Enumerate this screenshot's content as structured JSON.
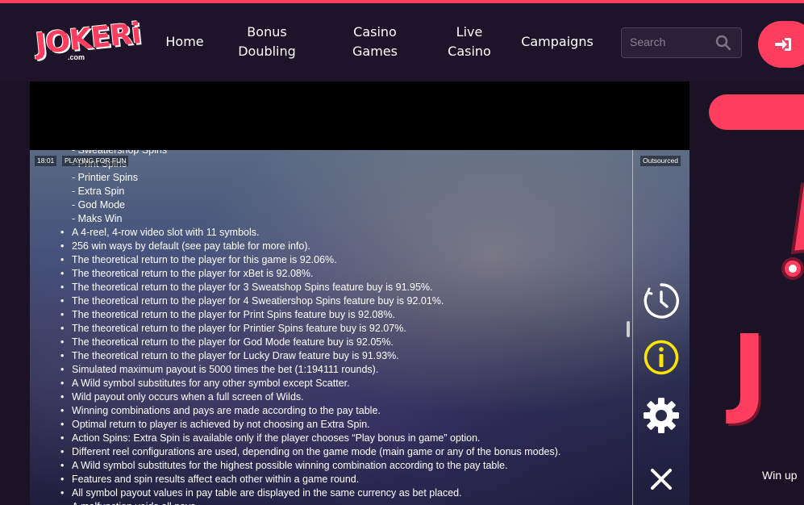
{
  "header": {
    "logo_text": "JOKERi",
    "logo_sub": ".com",
    "nav": [
      {
        "label": "Home"
      },
      {
        "label": "Bonus Doubling"
      },
      {
        "label": "Casino Games"
      },
      {
        "label": "Live Casino"
      },
      {
        "label": "Campaigns"
      }
    ],
    "search_placeholder": "Search",
    "login_icon": "login-icon"
  },
  "game": {
    "time": "18:01",
    "mode": "PLAYING FOR FUN",
    "provider_badge": "Outsourced",
    "lines": [
      {
        "type": "sub",
        "text": "- Sweatiershop Spins"
      },
      {
        "type": "sub",
        "text": "- Print Spins"
      },
      {
        "type": "sub",
        "text": "- Printier Spins"
      },
      {
        "type": "sub",
        "text": "- Extra Spin"
      },
      {
        "type": "sub",
        "text": "- God Mode"
      },
      {
        "type": "sub",
        "text": "- Maks Win"
      },
      {
        "type": "bullet",
        "text": "A 4-reel, 4-row video slot with 11 symbols."
      },
      {
        "type": "bullet",
        "text": "256 win ways by default (see pay table for more info)."
      },
      {
        "type": "bullet",
        "text": "The theoretical return to the player for this game is 92.06%."
      },
      {
        "type": "bullet",
        "text": "The theoretical return to the player for xBet is 92.08%."
      },
      {
        "type": "bullet",
        "text": "The theoretical return to the player for 3 Sweatshop Spins feature buy is 91.95%."
      },
      {
        "type": "bullet",
        "text": "The theoretical return to the player for 4 Sweatiershop Spins feature buy is 92.01%."
      },
      {
        "type": "bullet",
        "text": "The theoretical return to the player for Print Spins feature buy is 92.08%."
      },
      {
        "type": "bullet",
        "text": "The theoretical return to the player for Printier Spins feature buy is 92.07%."
      },
      {
        "type": "bullet",
        "text": "The theoretical return to the player for God Mode feature buy is 92.05%."
      },
      {
        "type": "bullet",
        "text": "The theoretical return to the player for Lucky Draw feature buy is 91.93%."
      },
      {
        "type": "bullet",
        "text": "Simulated maximum payout is 5000 times the bet (1:194111 rounds)."
      },
      {
        "type": "bullet",
        "text": "A Wild symbol substitutes for any other symbol except Scatter."
      },
      {
        "type": "bullet",
        "text": "Wild payout only occurs when a full screen of Wilds."
      },
      {
        "type": "bullet",
        "text": "Winning combinations and pays are made according to the pay table."
      },
      {
        "type": "bullet",
        "text": "Optimal return to player is achieved by not choosing an Extra Spin."
      },
      {
        "type": "bullet",
        "text": "Action Spins: Extra Spin is available only if the player chooses “Play bonus in game” option."
      },
      {
        "type": "bullet",
        "text": "Different reel configurations are used, depending on the game mode (main game or any of the bonus modes)."
      },
      {
        "type": "bullet",
        "text": "A Wild symbol substitutes for the highest possible winning combination according to the pay table."
      },
      {
        "type": "bullet",
        "text": "Features and spin results affect each other within a game round."
      },
      {
        "type": "bullet",
        "text": "All symbol payout values in pay table are displayed in the same currency as bet placed."
      },
      {
        "type": "bullet",
        "text": "A malfunction voids all pays."
      }
    ],
    "side_icons": [
      "history-clock-icon",
      "info-icon",
      "settings-gear-icon",
      "close-icon"
    ],
    "info_icon_color": "#ffe400"
  },
  "right_panel": {
    "win_text": "Win up"
  },
  "colors": {
    "accent": "#ff3d5e",
    "bg": "#1b1226"
  }
}
